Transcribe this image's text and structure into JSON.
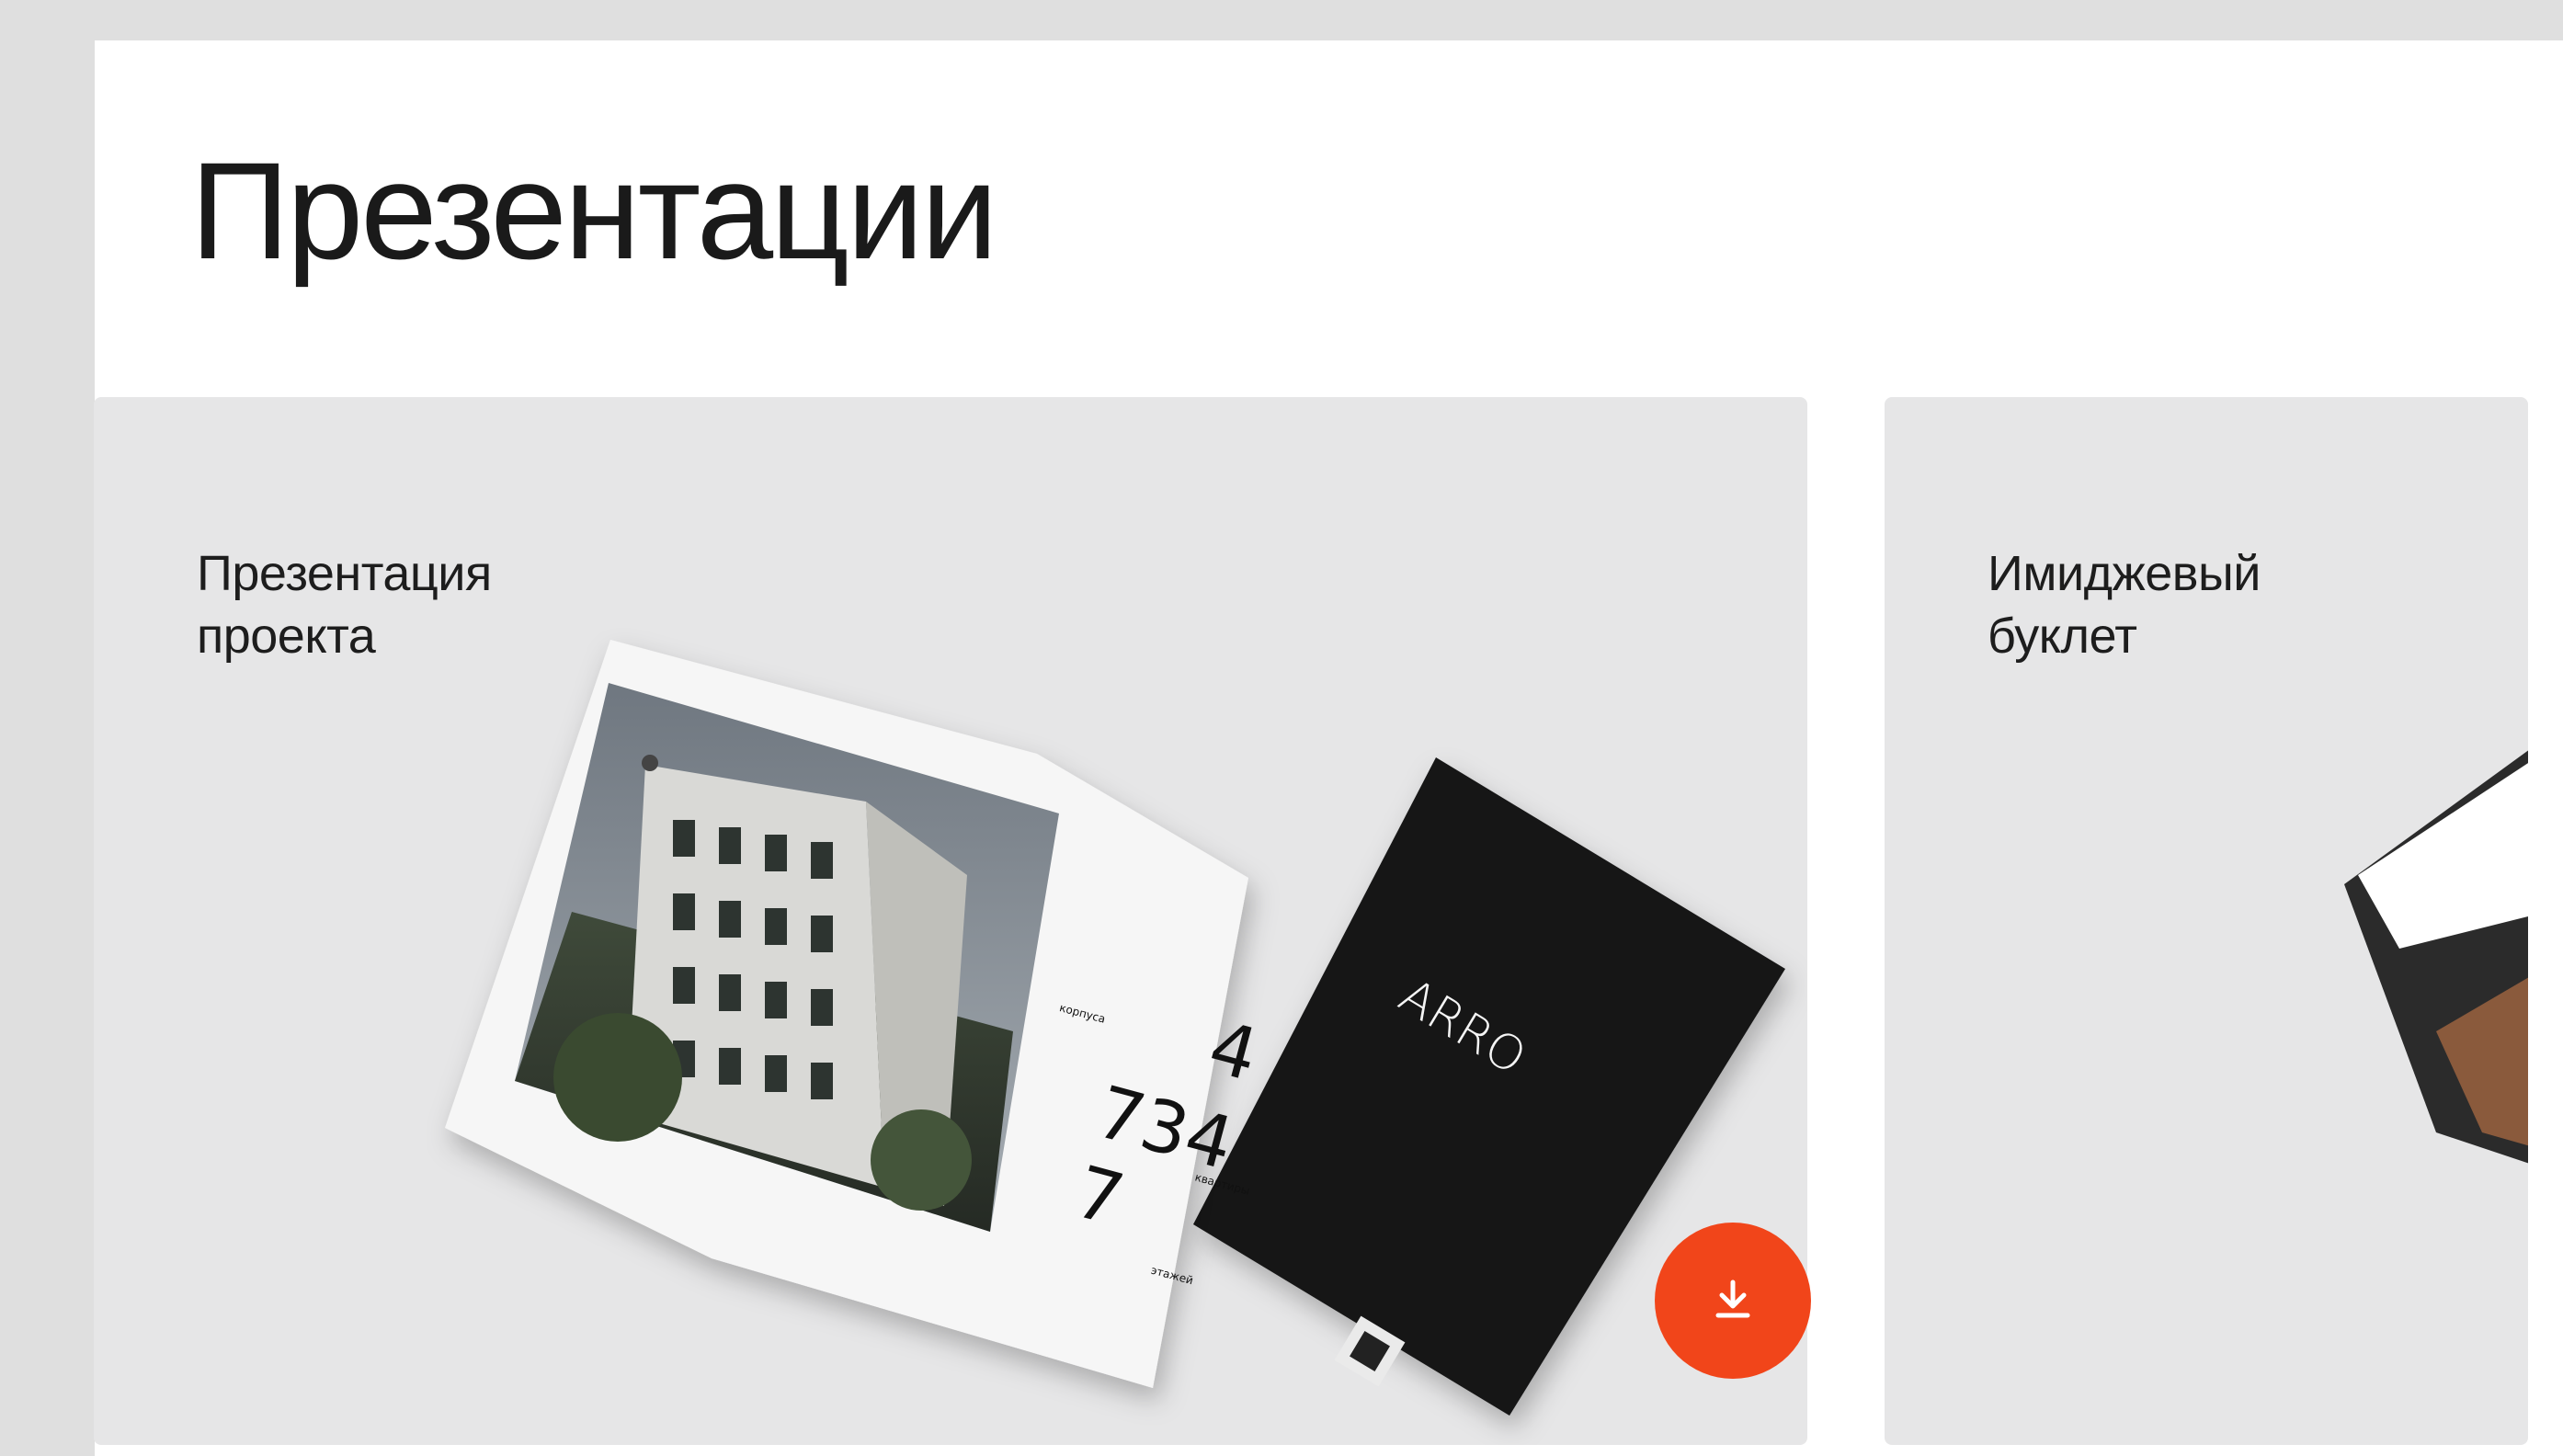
{
  "page": {
    "title": "Презентации"
  },
  "cards": [
    {
      "title_lines": [
        "Презентация",
        "проекта"
      ],
      "brochure": {
        "cover_logo": "ARRO",
        "stats": [
          "4",
          "734",
          "7"
        ],
        "stat_captions": [
          "корпуса",
          "квартиры",
          "этажей"
        ]
      },
      "download_icon": "download-icon"
    },
    {
      "title_lines": [
        "Имиджевый",
        "буклет"
      ]
    }
  ],
  "colors": {
    "accent": "#f1451a",
    "card_bg": "#e6e6e7",
    "cover": "#151515"
  }
}
